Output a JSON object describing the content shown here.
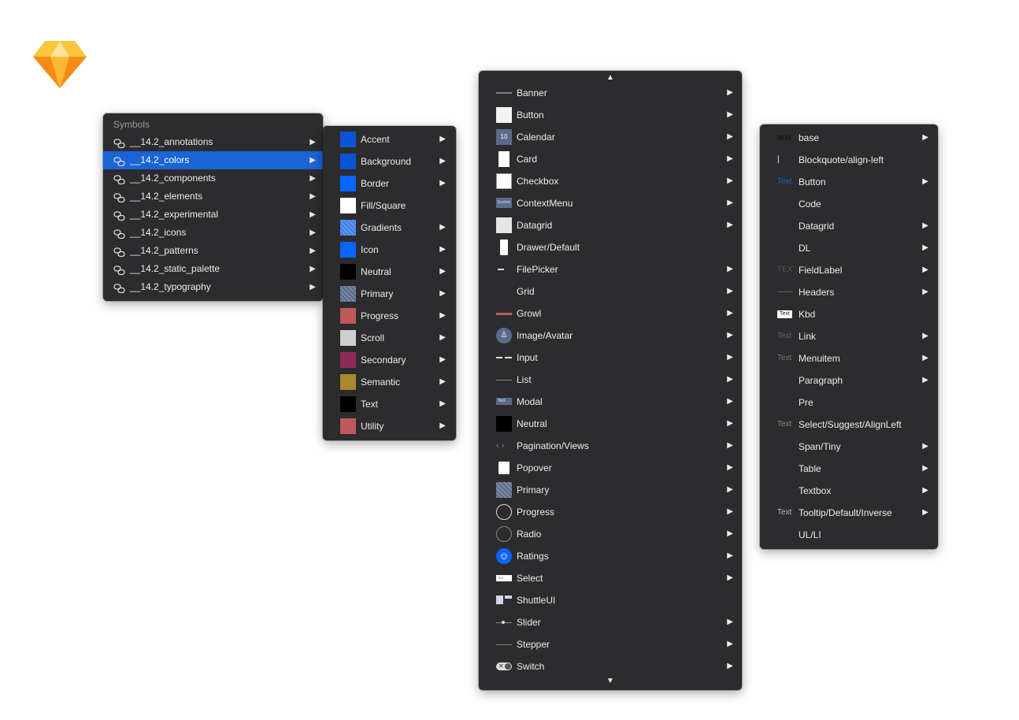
{
  "symbols_menu": {
    "header": "Symbols",
    "items": [
      {
        "label": "__14.2_annotations",
        "arrow": "▶"
      },
      {
        "label": "__14.2_colors",
        "arrow": "▶",
        "selected": true
      },
      {
        "label": "__14.2_components",
        "arrow": "▶"
      },
      {
        "label": "__14.2_elements",
        "arrow": "▶"
      },
      {
        "label": "__14.2_experimental",
        "arrow": "▶"
      },
      {
        "label": "__14.2_icons",
        "arrow": "▶"
      },
      {
        "label": "__14.2_patterns",
        "arrow": "▶"
      },
      {
        "label": "__14.2_static_palette",
        "arrow": "▶"
      },
      {
        "label": "__14.2_typography",
        "arrow": "▶"
      }
    ]
  },
  "colors_menu": {
    "items": [
      {
        "label": "Accent",
        "swatch": "#0b55d4",
        "arrow": "▶"
      },
      {
        "label": "Background",
        "swatch": "#0b55d4",
        "arrow": "▶"
      },
      {
        "label": "Border",
        "swatch": "#0a64ff",
        "arrow": "▶"
      },
      {
        "label": "Fill/Square",
        "swatch": "#ffffff",
        "arrow": ""
      },
      {
        "label": "Gradients",
        "swatch": "#3f7fe8",
        "arrow": "▶"
      },
      {
        "label": "Icon",
        "swatch": "#0a64ff",
        "arrow": "▶"
      },
      {
        "label": "Neutral",
        "swatch": "#000000",
        "arrow": "▶"
      },
      {
        "label": "Primary",
        "swatch": "#5b6b8c",
        "arrow": "▶"
      },
      {
        "label": "Progress",
        "swatch": "#c0595a",
        "arrow": "▶"
      },
      {
        "label": "Scroll",
        "swatch": "#cfcfcf",
        "arrow": "▶"
      },
      {
        "label": "Secondary",
        "swatch": "#8e2a5a",
        "arrow": "▶"
      },
      {
        "label": "Semantic",
        "swatch": "#a8892e",
        "arrow": "▶"
      },
      {
        "label": "Text",
        "swatch": "#000000",
        "arrow": "▶"
      },
      {
        "label": "Utility",
        "swatch": "#c0595a",
        "arrow": "▶"
      }
    ]
  },
  "components_menu": {
    "scroll_up": "▲",
    "scroll_down": "▼",
    "items": [
      {
        "label": "Banner",
        "thumb": "banner",
        "arrow": "▶"
      },
      {
        "label": "Button",
        "thumb": "white-square",
        "arrow": "▶"
      },
      {
        "label": "Calendar",
        "thumb": "calendar",
        "thumb_text": "10",
        "arrow": "▶"
      },
      {
        "label": "Card",
        "thumb": "card",
        "arrow": "▶"
      },
      {
        "label": "Checkbox",
        "thumb": "checkbox",
        "arrow": "▶"
      },
      {
        "label": "ContextMenu",
        "thumb": "contextmenu",
        "thumb_text": "Section",
        "arrow": "▶"
      },
      {
        "label": "Datagrid",
        "thumb": "light-square",
        "arrow": "▶"
      },
      {
        "label": "Drawer/Default",
        "thumb": "drawer",
        "arrow": ""
      },
      {
        "label": "FilePicker",
        "thumb": "dash",
        "arrow": "▶"
      },
      {
        "label": "Grid",
        "thumb": "none",
        "arrow": "▶"
      },
      {
        "label": "Growl",
        "thumb": "growl",
        "arrow": "▶"
      },
      {
        "label": "Image/Avatar",
        "thumb": "avatar",
        "arrow": "▶"
      },
      {
        "label": "Input",
        "thumb": "input",
        "arrow": "▶"
      },
      {
        "label": "List",
        "thumb": "line",
        "arrow": "▶"
      },
      {
        "label": "Modal",
        "thumb": "modal",
        "thumb_text": "Text",
        "arrow": "▶"
      },
      {
        "label": "Neutral",
        "thumb": "black-square",
        "arrow": "▶"
      },
      {
        "label": "Pagination/Views",
        "thumb": "pagination",
        "arrow": "▶"
      },
      {
        "label": "Popover",
        "thumb": "popover",
        "arrow": "▶"
      },
      {
        "label": "Primary",
        "thumb": "pattern",
        "arrow": "▶"
      },
      {
        "label": "Progress",
        "thumb": "ring",
        "arrow": "▶"
      },
      {
        "label": "Radio",
        "thumb": "ring-dark",
        "arrow": "▶"
      },
      {
        "label": "Ratings",
        "thumb": "smiley",
        "arrow": "▶"
      },
      {
        "label": "Select",
        "thumb": "select",
        "thumb_text": "Text",
        "arrow": "▶"
      },
      {
        "label": "ShuttleUI",
        "thumb": "shuttle",
        "arrow": ""
      },
      {
        "label": "Slider",
        "thumb": "slider",
        "arrow": "▶"
      },
      {
        "label": "Stepper",
        "thumb": "line",
        "arrow": "▶"
      },
      {
        "label": "Switch",
        "thumb": "switch",
        "arrow": "▶"
      }
    ]
  },
  "typography_menu": {
    "items": [
      {
        "label": "base",
        "preview": "text",
        "preview_color": "#111111",
        "arrow": "▶"
      },
      {
        "label": "Blockquote/align-left",
        "preview": "|",
        "preview_color": "#ffffff",
        "arrow": ""
      },
      {
        "label": "Button",
        "preview": "Text",
        "preview_color": "#1c5fd0",
        "arrow": "▶"
      },
      {
        "label": "Code",
        "preview": "",
        "preview_color": "#555555",
        "arrow": ""
      },
      {
        "label": "Datagrid",
        "preview": "",
        "preview_color": "#555555",
        "arrow": "▶"
      },
      {
        "label": "DL",
        "preview": "",
        "preview_color": "#555555",
        "arrow": "▶"
      },
      {
        "label": "FieldLabel",
        "preview": "TEXT",
        "preview_color": "#555555",
        "arrow": "▶"
      },
      {
        "label": "Headers",
        "preview": "——",
        "preview_color": "#777777",
        "arrow": "▶"
      },
      {
        "label": "Kbd",
        "preview": "Text",
        "preview_color": "#222222",
        "arrow": ""
      },
      {
        "label": "Link",
        "preview": "Text",
        "preview_color": "#666666",
        "arrow": "▶"
      },
      {
        "label": "Menuitem",
        "preview": "Text",
        "preview_color": "#777777",
        "arrow": "▶"
      },
      {
        "label": "Paragraph",
        "preview": "",
        "preview_color": "#555555",
        "arrow": "▶"
      },
      {
        "label": "Pre",
        "preview": "",
        "preview_color": "#555555",
        "arrow": ""
      },
      {
        "label": "Select/Suggest/AlignLeft",
        "preview": "Text",
        "preview_color": "#888888",
        "arrow": ""
      },
      {
        "label": "Span/Tiny",
        "preview": "",
        "preview_color": "#555555",
        "arrow": "▶"
      },
      {
        "label": "Table",
        "preview": "",
        "preview_color": "#555555",
        "arrow": "▶"
      },
      {
        "label": "Textbox",
        "preview": "",
        "preview_color": "#555555",
        "arrow": "▶"
      },
      {
        "label": "Tooltip/Default/Inverse",
        "preview": "Text",
        "preview_color": "#bbbbbb",
        "arrow": "▶"
      },
      {
        "label": "UL/LI",
        "preview": "",
        "preview_color": "#555555",
        "arrow": ""
      }
    ]
  },
  "colors": {
    "menu_bg": "#2c2c2e",
    "selection": "#1a64d6",
    "logo_orange": "#f7a51d"
  }
}
